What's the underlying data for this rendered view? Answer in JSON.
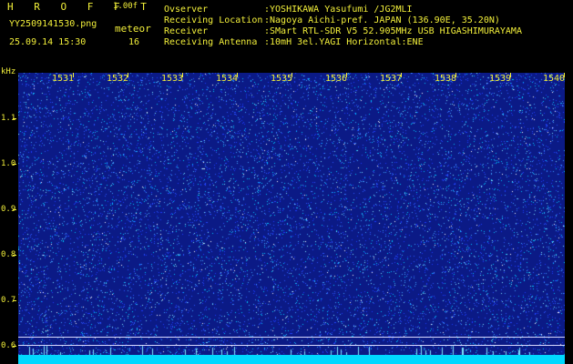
{
  "header": {
    "brand": "H R O F F T",
    "version": "1.00f",
    "filename": "YY2509141530.png",
    "mode": "meteor",
    "datetime": "25.09.14 15:30",
    "count": "16"
  },
  "meta": [
    {
      "label": "Ovserver",
      "value": ":YOSHIKAWA Yasufumi /JG2MLI"
    },
    {
      "label": "Receiving Location",
      "value": ":Nagoya Aichi-pref. JAPAN (136.90E, 35.20N)"
    },
    {
      "label": "Receiver",
      "value": ":SMart RTL-SDR V5 52.905MHz USB HIGASHIMURAYAMA"
    },
    {
      "label": "Receiving Antenna",
      "value": ":10mH 3el.YAGI Horizontal:ENE"
    }
  ],
  "axis": {
    "unit": "kHz",
    "y_ticks": [
      "1.1",
      "1.0",
      "0.9",
      "0.8",
      "0.7",
      "0.6"
    ],
    "x_ticks": [
      "1531",
      "1532",
      "1533",
      "1534",
      "1535",
      "1536",
      "1537",
      "1538",
      "1539",
      "1540"
    ]
  },
  "colors": {
    "text": "#f2ef3a",
    "background": "#0b1a86",
    "signal": "#00d8ff"
  }
}
